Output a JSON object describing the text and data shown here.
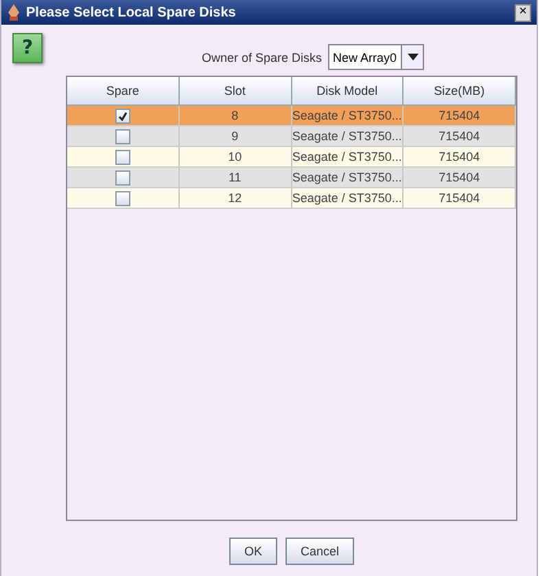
{
  "window": {
    "title": "Please Select Local Spare Disks",
    "close": "×"
  },
  "help": {
    "label": "?"
  },
  "owner": {
    "label": "Owner of Spare Disks",
    "value": "New Array0"
  },
  "table": {
    "columns": [
      "Spare",
      "Slot",
      "Disk Model",
      "Size(MB)"
    ],
    "rows": [
      {
        "checked": true,
        "selected": true,
        "slot": "8",
        "model": "Seagate / ST3750...",
        "size": "715404"
      },
      {
        "checked": false,
        "selected": false,
        "slot": "9",
        "model": "Seagate / ST3750...",
        "size": "715404"
      },
      {
        "checked": false,
        "selected": false,
        "slot": "10",
        "model": "Seagate / ST3750...",
        "size": "715404"
      },
      {
        "checked": false,
        "selected": false,
        "slot": "11",
        "model": "Seagate / ST3750...",
        "size": "715404"
      },
      {
        "checked": false,
        "selected": false,
        "slot": "12",
        "model": "Seagate / ST3750...",
        "size": "715404"
      }
    ]
  },
  "buttons": [
    "OK",
    "Cancel"
  ]
}
